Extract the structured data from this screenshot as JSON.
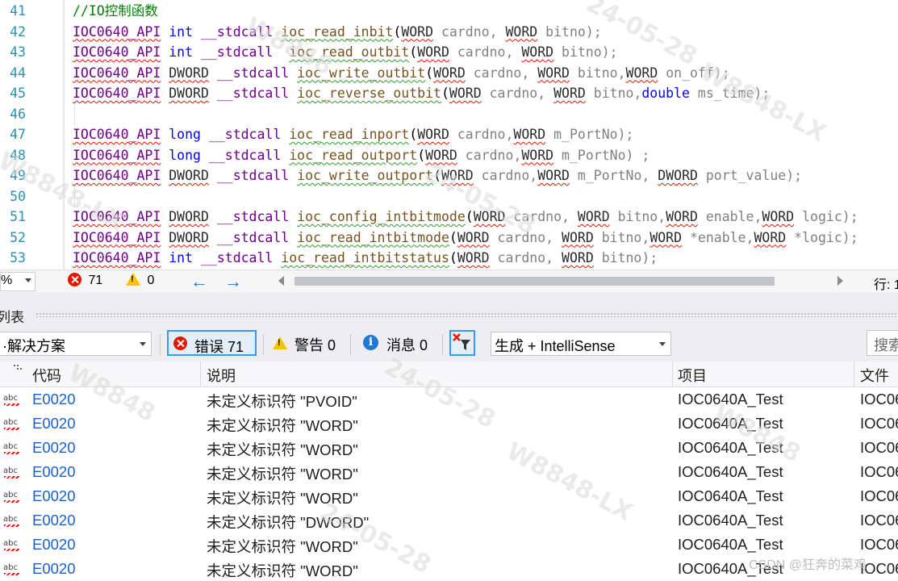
{
  "editor": {
    "lines": [
      {
        "num": "41",
        "tokens": [
          {
            "t": "//IO控制函数",
            "c": "comment"
          }
        ]
      },
      {
        "num": "42",
        "tokens": [
          {
            "t": "IOC0640_API",
            "c": "macro",
            "u": "red"
          },
          {
            "t": " int ",
            "c": "kw"
          },
          {
            "t": "__stdcall",
            "c": "macro"
          },
          {
            "t": " ",
            "c": "punct"
          },
          {
            "t": "ioc_read_inbit",
            "c": "fn",
            "u": "grn"
          },
          {
            "t": "(",
            "c": "punct"
          },
          {
            "t": "WORD",
            "c": "type",
            "u": "red"
          },
          {
            "t": " cardno, ",
            "c": "param"
          },
          {
            "t": "WORD",
            "c": "type",
            "u": "red"
          },
          {
            "t": " bitno);",
            "c": "param"
          }
        ]
      },
      {
        "num": "43",
        "tokens": [
          {
            "t": "IOC0640_API",
            "c": "macro",
            "u": "red"
          },
          {
            "t": " int ",
            "c": "kw"
          },
          {
            "t": "__stdcall",
            "c": "macro"
          },
          {
            "t": "  ",
            "c": "punct"
          },
          {
            "t": "ioc_read_outbit",
            "c": "fn",
            "u": "grn"
          },
          {
            "t": "(",
            "c": "punct"
          },
          {
            "t": "WORD",
            "c": "type",
            "u": "red"
          },
          {
            "t": " cardno, ",
            "c": "param"
          },
          {
            "t": "WORD",
            "c": "type",
            "u": "red"
          },
          {
            "t": " bitno);",
            "c": "param"
          }
        ]
      },
      {
        "num": "44",
        "tokens": [
          {
            "t": "IOC0640_API",
            "c": "macro",
            "u": "red"
          },
          {
            "t": " ",
            "c": "punct"
          },
          {
            "t": "DWORD",
            "c": "type",
            "u": "red"
          },
          {
            "t": " __stdcall ",
            "c": "macro"
          },
          {
            "t": "ioc_write_outbit",
            "c": "fn",
            "u": "grn"
          },
          {
            "t": "(",
            "c": "punct"
          },
          {
            "t": "WORD",
            "c": "type",
            "u": "red"
          },
          {
            "t": " cardno, ",
            "c": "param"
          },
          {
            "t": "WORD",
            "c": "type",
            "u": "red"
          },
          {
            "t": " bitno,",
            "c": "param"
          },
          {
            "t": "WORD",
            "c": "type",
            "u": "red"
          },
          {
            "t": " on_off);",
            "c": "param"
          }
        ]
      },
      {
        "num": "45",
        "tokens": [
          {
            "t": "IOC0640_API",
            "c": "macro",
            "u": "red"
          },
          {
            "t": " ",
            "c": "punct"
          },
          {
            "t": "DWORD",
            "c": "type",
            "u": "red"
          },
          {
            "t": " __stdcall ",
            "c": "macro"
          },
          {
            "t": "ioc_reverse_outbit",
            "c": "fn",
            "u": "grn"
          },
          {
            "t": "(",
            "c": "punct"
          },
          {
            "t": "WORD",
            "c": "type",
            "u": "red"
          },
          {
            "t": " cardno, ",
            "c": "param"
          },
          {
            "t": "WORD",
            "c": "type",
            "u": "red"
          },
          {
            "t": " bitno,",
            "c": "param"
          },
          {
            "t": "double",
            "c": "kw"
          },
          {
            "t": " ms_time);",
            "c": "param"
          }
        ]
      },
      {
        "num": "46",
        "tokens": []
      },
      {
        "num": "47",
        "tokens": [
          {
            "t": "IOC0640_API",
            "c": "macro",
            "u": "red"
          },
          {
            "t": " long ",
            "c": "kw"
          },
          {
            "t": "__stdcall",
            "c": "macro"
          },
          {
            "t": " ",
            "c": "punct"
          },
          {
            "t": "ioc_read_inport",
            "c": "fn",
            "u": "grn"
          },
          {
            "t": "(",
            "c": "punct"
          },
          {
            "t": "WORD",
            "c": "type",
            "u": "red"
          },
          {
            "t": " cardno,",
            "c": "param"
          },
          {
            "t": "WORD",
            "c": "type",
            "u": "red"
          },
          {
            "t": " m_PortNo);",
            "c": "param"
          }
        ]
      },
      {
        "num": "48",
        "tokens": [
          {
            "t": "IOC0640_API",
            "c": "macro",
            "u": "red"
          },
          {
            "t": " long ",
            "c": "kw"
          },
          {
            "t": "__stdcall",
            "c": "macro"
          },
          {
            "t": " ",
            "c": "punct"
          },
          {
            "t": "ioc_read_outport",
            "c": "fn",
            "u": "grn"
          },
          {
            "t": "(",
            "c": "punct"
          },
          {
            "t": "WORD",
            "c": "type",
            "u": "red"
          },
          {
            "t": " cardno,",
            "c": "param"
          },
          {
            "t": "WORD",
            "c": "type",
            "u": "red"
          },
          {
            "t": " m_PortNo) ;",
            "c": "param"
          }
        ]
      },
      {
        "num": "49",
        "tokens": [
          {
            "t": "IOC0640_API",
            "c": "macro",
            "u": "red"
          },
          {
            "t": " ",
            "c": "punct"
          },
          {
            "t": "DWORD",
            "c": "type",
            "u": "red"
          },
          {
            "t": " __stdcall ",
            "c": "macro"
          },
          {
            "t": "ioc_write_outport",
            "c": "fn",
            "u": "grn"
          },
          {
            "t": "(",
            "c": "punct"
          },
          {
            "t": "WORD",
            "c": "type",
            "u": "red"
          },
          {
            "t": " cardno,",
            "c": "param"
          },
          {
            "t": "WORD",
            "c": "type",
            "u": "red"
          },
          {
            "t": " m_PortNo, ",
            "c": "param"
          },
          {
            "t": "DWORD",
            "c": "type",
            "u": "red"
          },
          {
            "t": " port_value);",
            "c": "param"
          }
        ]
      },
      {
        "num": "50",
        "tokens": []
      },
      {
        "num": "51",
        "tokens": [
          {
            "t": "IOC0640_API",
            "c": "macro",
            "u": "red"
          },
          {
            "t": " ",
            "c": "punct"
          },
          {
            "t": "DWORD",
            "c": "type",
            "u": "red"
          },
          {
            "t": " __stdcall ",
            "c": "macro"
          },
          {
            "t": "ioc_config_intbitmode",
            "c": "fn",
            "u": "grn"
          },
          {
            "t": "(",
            "c": "punct"
          },
          {
            "t": "WORD",
            "c": "type",
            "u": "red"
          },
          {
            "t": " cardno, ",
            "c": "param"
          },
          {
            "t": "WORD",
            "c": "type",
            "u": "red"
          },
          {
            "t": " bitno,",
            "c": "param"
          },
          {
            "t": "WORD",
            "c": "type",
            "u": "red"
          },
          {
            "t": " enable,",
            "c": "param"
          },
          {
            "t": "WORD",
            "c": "type",
            "u": "red"
          },
          {
            "t": " logic);",
            "c": "param"
          }
        ]
      },
      {
        "num": "52",
        "tokens": [
          {
            "t": "IOC0640_API",
            "c": "macro",
            "u": "red"
          },
          {
            "t": " ",
            "c": "punct"
          },
          {
            "t": "DWORD",
            "c": "type",
            "u": "red"
          },
          {
            "t": " __stdcall ",
            "c": "macro"
          },
          {
            "t": "ioc_read_intbitmode",
            "c": "fn",
            "u": "grn"
          },
          {
            "t": "(",
            "c": "punct"
          },
          {
            "t": "WORD",
            "c": "type",
            "u": "red"
          },
          {
            "t": " cardno, ",
            "c": "param"
          },
          {
            "t": "WORD",
            "c": "type",
            "u": "red"
          },
          {
            "t": " bitno,",
            "c": "param"
          },
          {
            "t": "WORD",
            "c": "type",
            "u": "red"
          },
          {
            "t": " *enable,",
            "c": "param"
          },
          {
            "t": "WORD",
            "c": "type",
            "u": "red"
          },
          {
            "t": " *logic);",
            "c": "param"
          }
        ]
      },
      {
        "num": "53",
        "tokens": [
          {
            "t": "IOC0640_API",
            "c": "macro",
            "u": "red"
          },
          {
            "t": " int ",
            "c": "kw"
          },
          {
            "t": "__stdcall",
            "c": "macro"
          },
          {
            "t": " ",
            "c": "punct"
          },
          {
            "t": "ioc_read_intbitstatus",
            "c": "fn",
            "u": "grn"
          },
          {
            "t": "(",
            "c": "punct"
          },
          {
            "t": "WORD",
            "c": "type",
            "u": "red"
          },
          {
            "t": " cardno, ",
            "c": "param"
          },
          {
            "t": "WORD",
            "c": "type",
            "u": "red"
          },
          {
            "t": " bitno);",
            "c": "param"
          }
        ]
      }
    ]
  },
  "editor_status": {
    "zoom": "%",
    "errors": "71",
    "warnings": "0",
    "line_label": "行: 1"
  },
  "panel": {
    "title": "列表"
  },
  "toolbar": {
    "scope": "·解决方案",
    "errors_label": "错误 71",
    "warnings_label": "警告 0",
    "messages_label": "消息 0",
    "build_filter": "生成 + IntelliSense",
    "search_placeholder": "搜索"
  },
  "grid": {
    "headers": {
      "code": "代码",
      "desc": "说明",
      "proj": "项目",
      "file": "文件"
    },
    "rows": [
      {
        "icon": "abc",
        "code": "E0020",
        "desc": "未定义标识符 \"PVOID\"",
        "proj": "IOC0640A_Test",
        "file": "IOC06"
      },
      {
        "icon": "abc",
        "code": "E0020",
        "desc": "未定义标识符 \"WORD\"",
        "proj": "IOC0640A_Test",
        "file": "IOC06"
      },
      {
        "icon": "abc",
        "code": "E0020",
        "desc": "未定义标识符 \"WORD\"",
        "proj": "IOC0640A_Test",
        "file": "IOC06"
      },
      {
        "icon": "abc",
        "code": "E0020",
        "desc": "未定义标识符 \"WORD\"",
        "proj": "IOC0640A_Test",
        "file": "IOC06"
      },
      {
        "icon": "abc",
        "code": "E0020",
        "desc": "未定义标识符 \"WORD\"",
        "proj": "IOC0640A_Test",
        "file": "IOC06"
      },
      {
        "icon": "abc",
        "code": "E0020",
        "desc": "未定义标识符 \"DWORD\"",
        "proj": "IOC0640A_Test",
        "file": "IOC06"
      },
      {
        "icon": "abc",
        "code": "E0020",
        "desc": "未定义标识符 \"WORD\"",
        "proj": "IOC0640A_Test",
        "file": "IOC06"
      },
      {
        "icon": "abc",
        "code": "E0020",
        "desc": "未定义标识符 \"WORD\"",
        "proj": "IOC0640A_Test",
        "file": "IOC06"
      }
    ]
  },
  "watermarks": [
    "W8848",
    "24-05-28",
    "W8848-LX"
  ],
  "credit": "CSDN @狂奔的菜鸡",
  "colors": {
    "error_red": "#e51400",
    "accent_blue": "#3399ff",
    "link_blue": "#1a62c9",
    "line_number": "#2b91af"
  }
}
